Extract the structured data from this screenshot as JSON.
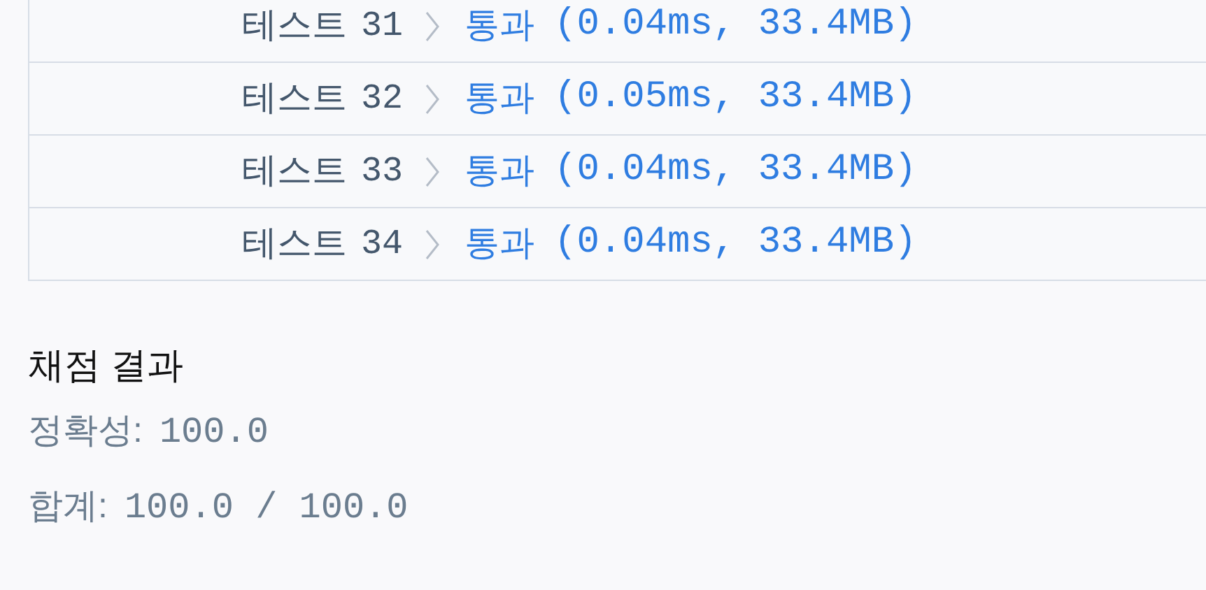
{
  "tests": [
    {
      "label": "테스트",
      "number": "31",
      "result": "통과",
      "detail": "(0.04ms, 33.4MB)"
    },
    {
      "label": "테스트",
      "number": "32",
      "result": "통과",
      "detail": "(0.05ms, 33.4MB)"
    },
    {
      "label": "테스트",
      "number": "33",
      "result": "통과",
      "detail": "(0.04ms, 33.4MB)"
    },
    {
      "label": "테스트",
      "number": "34",
      "result": "통과",
      "detail": "(0.04ms, 33.4MB)"
    }
  ],
  "grading": {
    "title": "채점 결과",
    "lines": [
      {
        "label": "정확성:",
        "value": "100.0"
      },
      {
        "label": "합계:",
        "value": "100.0 / 100.0"
      }
    ]
  }
}
